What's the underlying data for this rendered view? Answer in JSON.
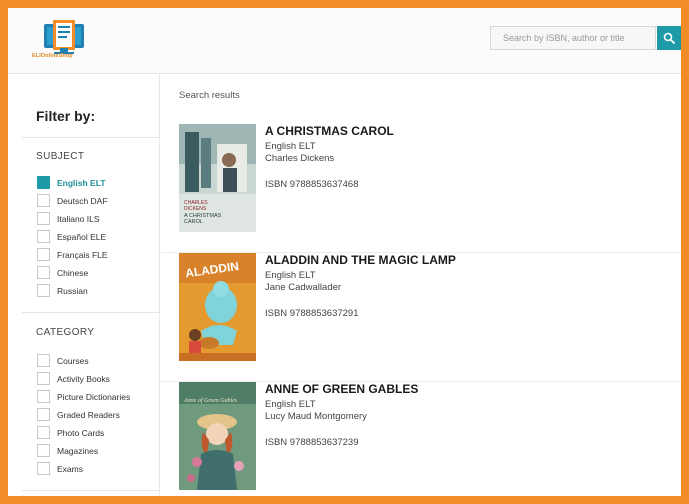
{
  "header": {
    "logo_text": "ELIOnlineShop",
    "search_placeholder": "Search by ISBN, author or title"
  },
  "sidebar": {
    "filter_title": "Filter by:",
    "subject": {
      "title": "SUBJECT",
      "options": [
        {
          "label": "English ELT",
          "checked": true
        },
        {
          "label": "Deutsch DAF",
          "checked": false
        },
        {
          "label": "Italiano ILS",
          "checked": false
        },
        {
          "label": "Español ELE",
          "checked": false
        },
        {
          "label": "Français FLE",
          "checked": false
        },
        {
          "label": "Chinese",
          "checked": false
        },
        {
          "label": "Russian",
          "checked": false
        }
      ]
    },
    "category": {
      "title": "CATEGORY",
      "options": [
        {
          "label": "Courses",
          "checked": false
        },
        {
          "label": "Activity Books",
          "checked": false
        },
        {
          "label": "Picture Dictionaries",
          "checked": false
        },
        {
          "label": "Graded Readers",
          "checked": false
        },
        {
          "label": "Photo Cards",
          "checked": false
        },
        {
          "label": "Magazines",
          "checked": false
        },
        {
          "label": "Exams",
          "checked": false
        }
      ]
    }
  },
  "main": {
    "results_label": "Search results",
    "results": [
      {
        "title": "A CHRISTMAS CAROL",
        "subject": "English ELT",
        "author": "Charles Dickens",
        "isbn": "ISBN 9788853637468",
        "cover_text": "CHARLES DICKENS A CHRISTMAS CAROL"
      },
      {
        "title": "ALADDIN AND THE MAGIC LAMP",
        "subject": "English ELT",
        "author": "Jane Cadwallader",
        "isbn": "ISBN 9788853637291",
        "cover_text": "ALADDIN"
      },
      {
        "title": "ANNE OF GREEN GABLES",
        "subject": "English ELT",
        "author": "Lucy Maud Montgomery",
        "isbn": "ISBN 9788853637239",
        "cover_text": "Anne of Green Gables"
      }
    ]
  },
  "colors": {
    "frame": "#f28c28",
    "accent": "#1e9aa6"
  }
}
